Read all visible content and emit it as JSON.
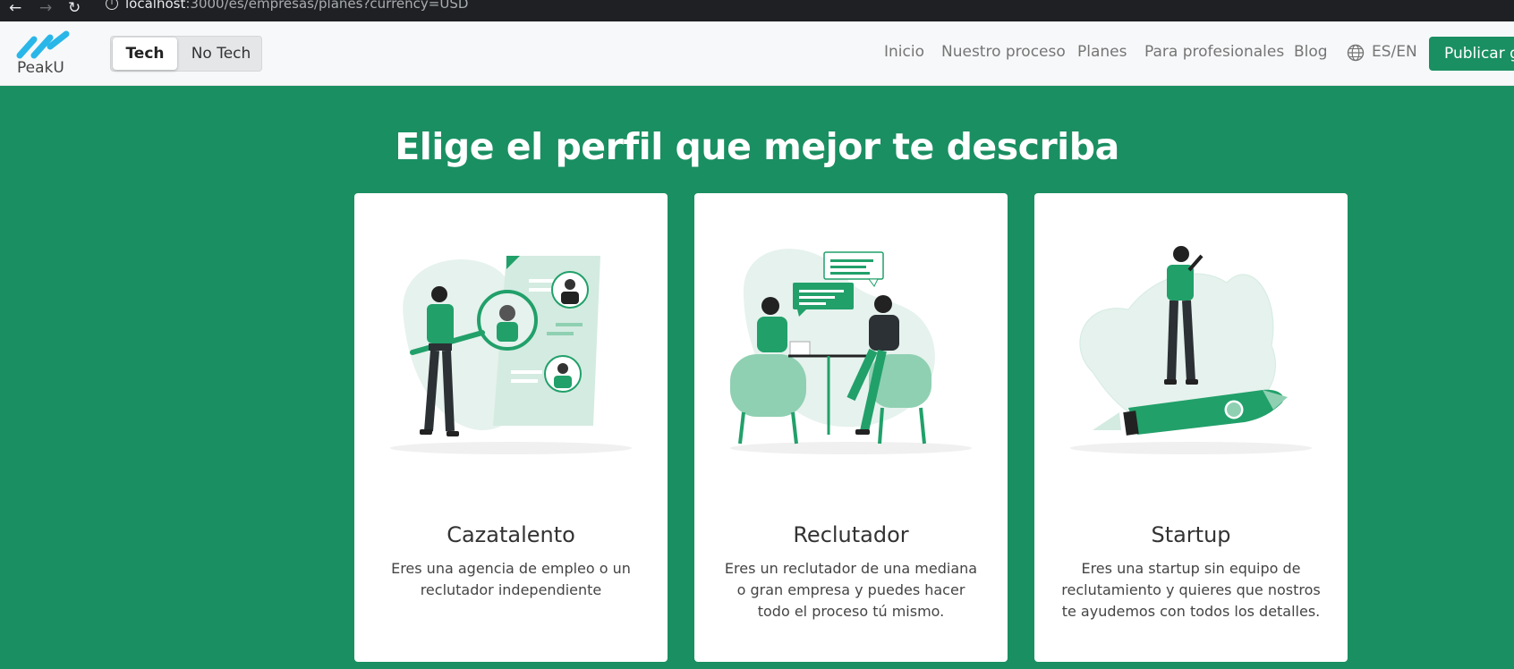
{
  "browser": {
    "back_icon": "arrow-left-icon",
    "forward_icon": "arrow-right-icon",
    "reload_icon": "reload-icon",
    "url_host": "localhost",
    "url_rest": ":3000/es/empresas/planes?currency=USD"
  },
  "navbar": {
    "logo_text": "PeakU",
    "toggle": {
      "tech": "Tech",
      "no_tech": "No Tech",
      "selected": "Tech"
    },
    "menu": [
      "Inicio",
      "Nuestro proceso",
      "Planes",
      "Para profesionales",
      "Blog"
    ],
    "language": "ES/EN",
    "cta": "Publicar gratis"
  },
  "hero": {
    "title": "Elige el perfil que mejor te describa"
  },
  "cards": [
    {
      "title": "Cazatalento",
      "text": "Eres una agencia de empleo o un reclutador independiente"
    },
    {
      "title": "Reclutador",
      "text": "Eres un reclutador de una mediana o gran empresa y puedes hacer todo el proceso tú mismo."
    },
    {
      "title": "Startup",
      "text": "Eres una startup sin equipo de reclutamiento y quieres que nostros te ayudemos con todos los detalles."
    }
  ],
  "colors": {
    "brand_green": "#1a8f62",
    "logo_blue": "#29b6e8",
    "illustration_green": "#21a06a"
  }
}
